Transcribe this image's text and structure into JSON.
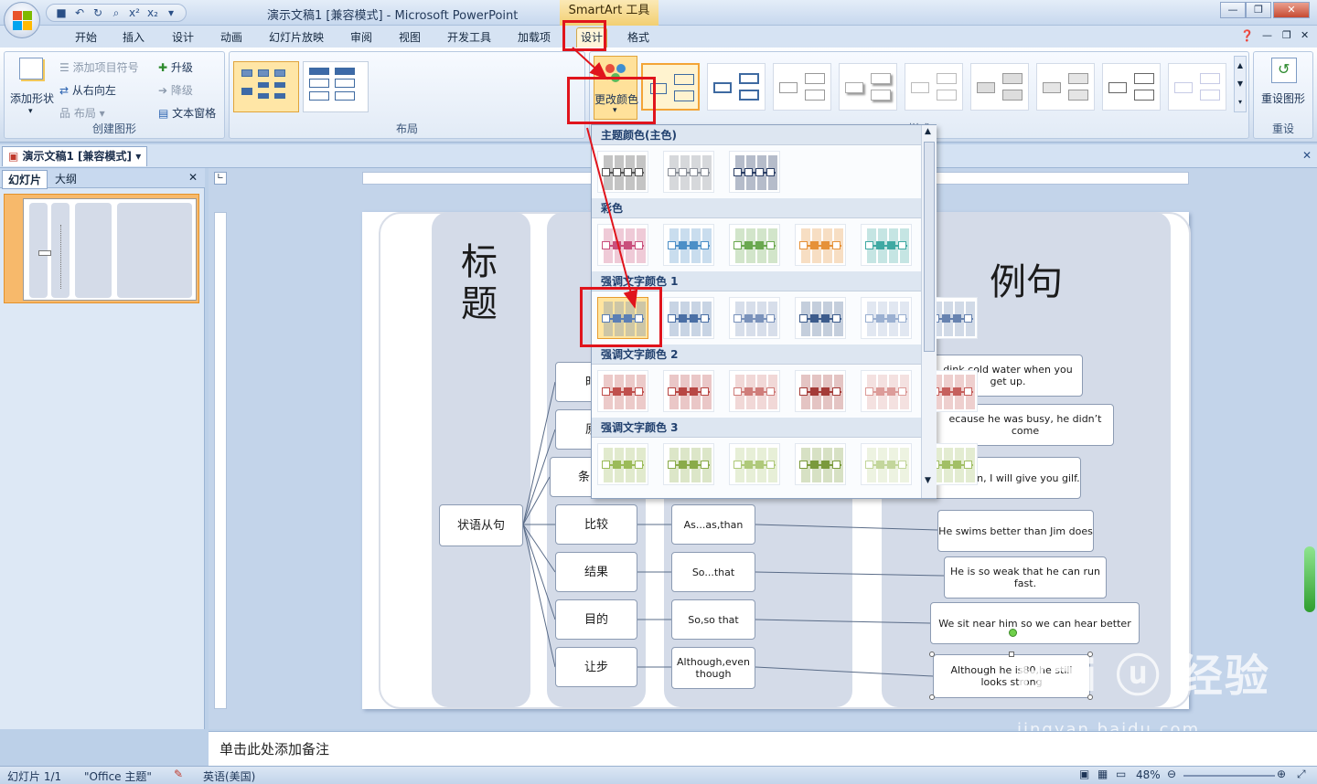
{
  "window": {
    "title": "演示文稿1 [兼容模式] - Microsoft PowerPoint",
    "contextual_tools": "SmartArt 工具"
  },
  "tabs": [
    "开始",
    "插入",
    "设计",
    "动画",
    "幻灯片放映",
    "审阅",
    "视图",
    "开发工具",
    "加载项",
    "设计",
    "格式"
  ],
  "ribbon": {
    "create_group": {
      "label": "创建图形",
      "add_shape": "添加形状",
      "add_bullet": "添加项目符号",
      "right_to_left": "从右向左",
      "layout": "布局",
      "promote": "升级",
      "demote": "降级",
      "text_pane": "文本窗格"
    },
    "layout_group": {
      "label": "布局"
    },
    "styles_group": {
      "label": "样式",
      "change_colors": "更改颜色"
    },
    "reset_group": {
      "label": "重设",
      "reset_graphic": "重设图形"
    }
  },
  "document_tab": "演示文稿1 [兼容模式]",
  "left_panel": {
    "tab_slides": "幻灯片",
    "tab_outline": "大纲",
    "slide_number": "1"
  },
  "gallery": {
    "sections": [
      {
        "title": "主题颜色(主色)",
        "count": 3,
        "colors": [
          "#555555",
          "#8a8f98",
          "#2b3f66"
        ]
      },
      {
        "title": "彩色",
        "count": 5,
        "colors": [
          "#c94f7c",
          "#4c8fc7",
          "#6aa84f",
          "#e69138",
          "#3fa9a3"
        ]
      },
      {
        "title": "强调文字颜色 1",
        "count": 6,
        "colors": [
          "#5b7fb5",
          "#4a6fa5",
          "#7a92bb",
          "#3d5c8c",
          "#9bb0d1",
          "#6783b0"
        ]
      },
      {
        "title": "强调文字颜色 2",
        "count": 6,
        "colors": [
          "#c0504d",
          "#b84744",
          "#cf7d7a",
          "#a43b38",
          "#dc9c99",
          "#c6605d"
        ]
      },
      {
        "title": "强调文字颜色 3",
        "count": 6,
        "colors": [
          "#9bbb59",
          "#8aab4a",
          "#afc97a",
          "#7a9a3c",
          "#c3d69c",
          "#a2bf66"
        ]
      }
    ]
  },
  "slide": {
    "header_title": "标题",
    "header_example": "例句",
    "root": "状语从句",
    "categories": [
      "比较",
      "结果",
      "目的",
      "让步"
    ],
    "partial_categories": [
      "时",
      "原",
      "条"
    ],
    "connectives": [
      "As...as,than",
      "So...that",
      "So,so that",
      "Although,even though"
    ],
    "examples": [
      "dink cold water when you get up.",
      "ecause he was busy, he didn’t come",
      "f you win, I will  give you gilf.",
      "He swims better than Jim does",
      "He is  so weak that he  can run  fast.",
      "We  sit near him so we can  hear better",
      "Although he is80,he still looks strong"
    ]
  },
  "notes_placeholder": "单击此处添加备注",
  "status": {
    "slide": "幻灯片 1/1",
    "theme": "\"Office 主题\"",
    "language": "英语(美国)",
    "zoom": "48%"
  },
  "watermark": {
    "text": "Bai 经验",
    "url": "jingyan.baidu.com"
  }
}
